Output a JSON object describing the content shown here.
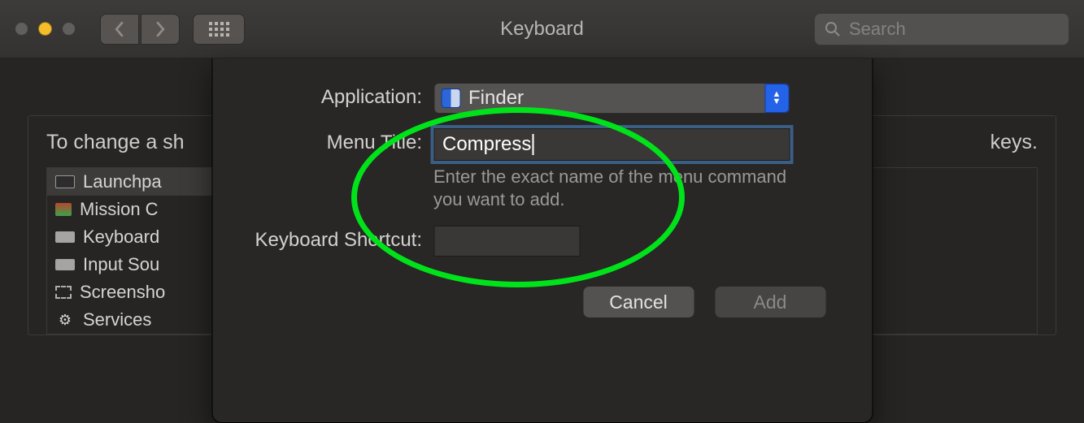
{
  "window": {
    "title": "Keyboard",
    "search_placeholder": "Search"
  },
  "background": {
    "instruction_partial": "To change a sh",
    "instruction_trail": "keys.",
    "sidebar_items": [
      {
        "label": "Launchpa"
      },
      {
        "label": "Mission C"
      },
      {
        "label": "Keyboard"
      },
      {
        "label": "Input Sou"
      },
      {
        "label": "Screensho"
      },
      {
        "label": "Services"
      }
    ]
  },
  "sheet": {
    "application_label": "Application:",
    "application_value": "Finder",
    "menu_title_label": "Menu Title:",
    "menu_title_value": "Compress",
    "menu_title_hint": "Enter the exact name of the menu command you want to add.",
    "shortcut_label": "Keyboard Shortcut:",
    "cancel": "Cancel",
    "add": "Add"
  }
}
